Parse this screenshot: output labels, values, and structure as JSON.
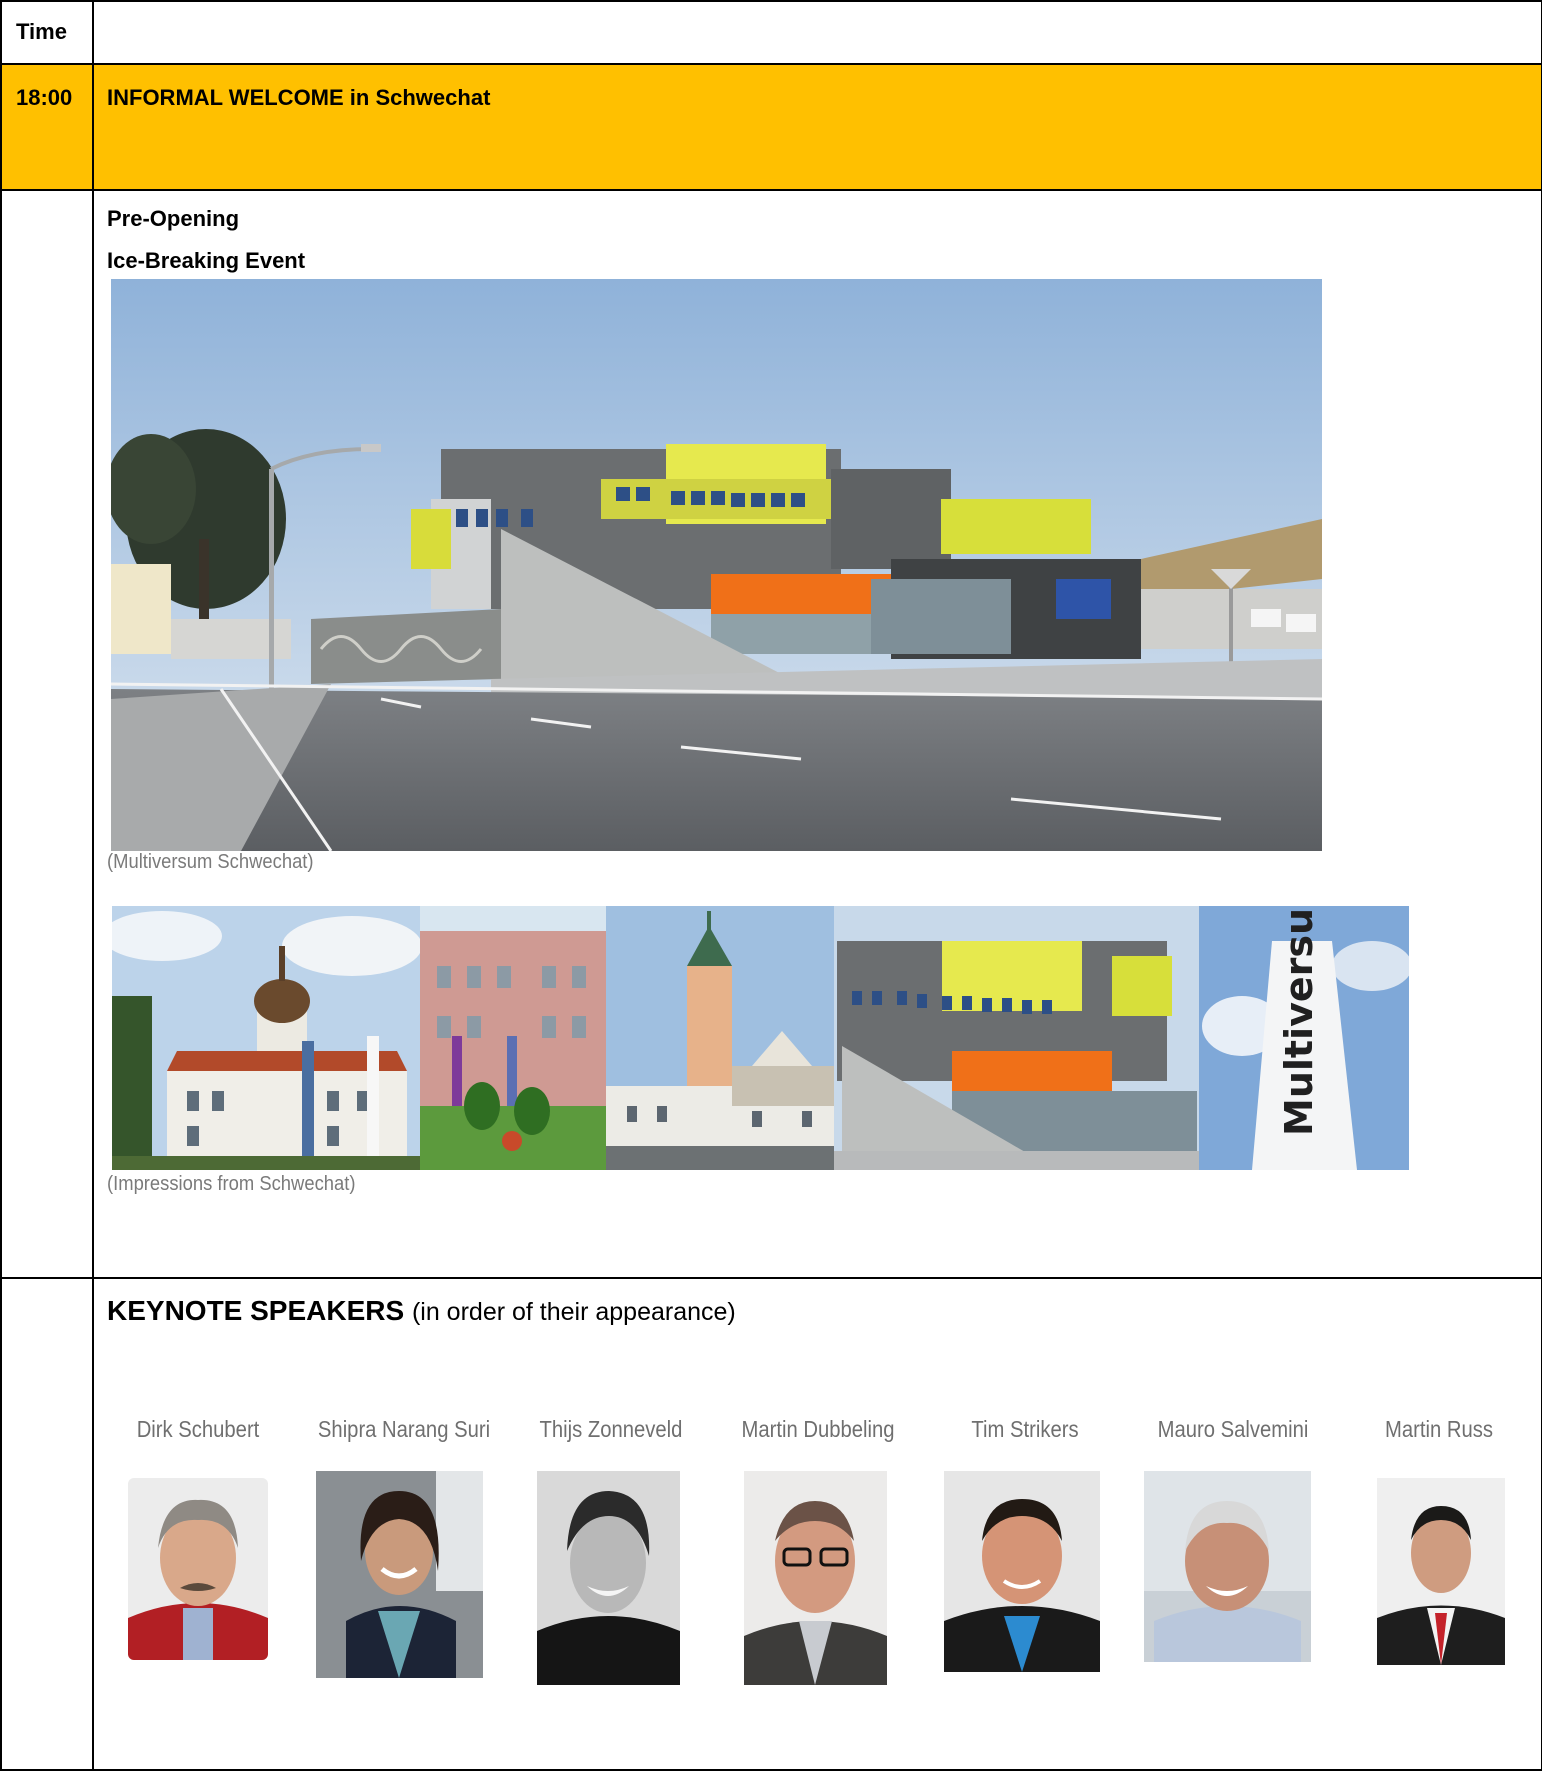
{
  "header": {
    "time_label": "Time",
    "main_label": ""
  },
  "welcome": {
    "time": "18:00",
    "title": "INFORMAL WELCOME in Schwechat"
  },
  "pre_opening": {
    "line1": "Pre-Opening",
    "line2": "Ice-Breaking Event",
    "caption_main": "(Multiversum Schwechat)",
    "caption_strip": "(Impressions from Schwechat)",
    "sign_text": "Multiversum"
  },
  "keynote": {
    "title": "KEYNOTE SPEAKERS",
    "subtitle": "(in order of their appearance)",
    "speakers": [
      {
        "name": "Dirk Schubert"
      },
      {
        "name": "Shipra Narang Suri"
      },
      {
        "name": "Thijs Zonneveld"
      },
      {
        "name": "Martin Dubbeling"
      },
      {
        "name": "Tim Strikers"
      },
      {
        "name": "Mauro Salvemini"
      },
      {
        "name": "Martin Russ"
      }
    ]
  },
  "colors": {
    "welcome_band": "#ffc000",
    "caption_gray": "#7a7a7a",
    "name_gray": "#6f6f6f"
  }
}
